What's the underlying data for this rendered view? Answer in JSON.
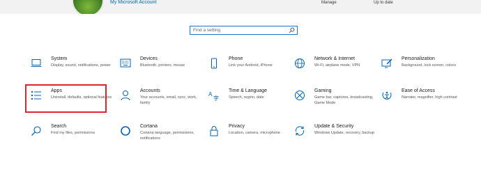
{
  "header": {
    "account_link": "My Microsoft Account",
    "manage": "Manage",
    "up_to_date": "Up to date"
  },
  "search": {
    "placeholder": "Find a setting"
  },
  "accent_color": "#0063b1",
  "highlight_color": "#d9252b",
  "tiles": [
    {
      "title": "System",
      "desc": "Display, sound, notifications, power",
      "icon": "laptop-icon"
    },
    {
      "title": "Devices",
      "desc": "Bluetooth, printers, mouse",
      "icon": "keyboard-icon"
    },
    {
      "title": "Phone",
      "desc": "Link your Android, iPhone",
      "icon": "phone-icon"
    },
    {
      "title": "Network & Internet",
      "desc": "Wi-Fi, airplane mode, VPN",
      "icon": "globe-icon"
    },
    {
      "title": "Personalization",
      "desc": "Background, lock screen, colors",
      "icon": "paint-icon"
    },
    {
      "title": "Apps",
      "desc": "Uninstall, defaults, optional features",
      "icon": "list-icon"
    },
    {
      "title": "Accounts",
      "desc": "Your accounts, email, sync, work, family",
      "icon": "person-icon"
    },
    {
      "title": "Time & Language",
      "desc": "Speech, region, date",
      "icon": "time-language-icon"
    },
    {
      "title": "Gaming",
      "desc": "Game bar, captures, broadcasting, Game Mode",
      "icon": "xbox-icon"
    },
    {
      "title": "Ease of Access",
      "desc": "Narrator, magnifier, high contrast",
      "icon": "ease-of-access-icon"
    },
    {
      "title": "Search",
      "desc": "Find my files, permissions",
      "icon": "search-icon"
    },
    {
      "title": "Cortana",
      "desc": "Cortana language, permissions, notifications",
      "icon": "cortana-icon"
    },
    {
      "title": "Privacy",
      "desc": "Location, camera, microphone",
      "icon": "lock-icon"
    },
    {
      "title": "Update & Security",
      "desc": "Windows Update, recovery, backup",
      "icon": "update-icon"
    }
  ]
}
